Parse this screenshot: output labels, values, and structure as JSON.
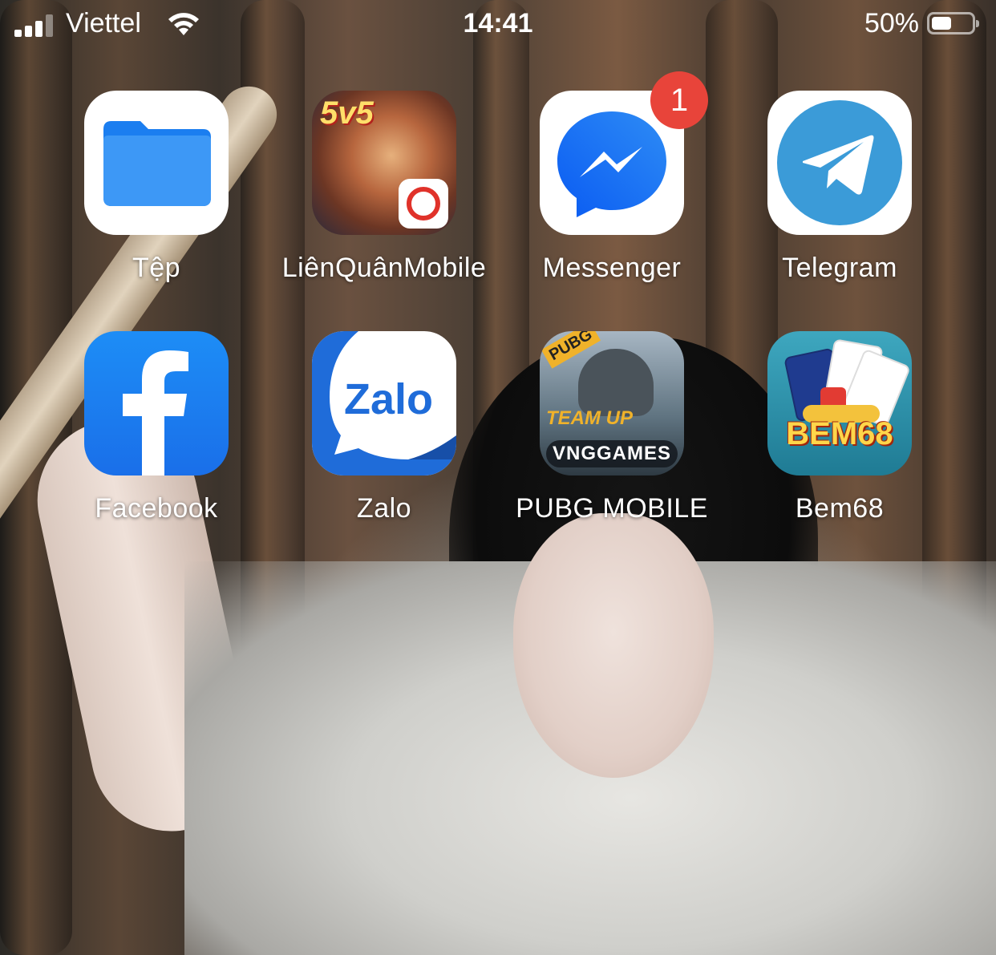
{
  "status_bar": {
    "carrier": "Viettel",
    "time": "14:41",
    "battery_percent_label": "50%",
    "battery_level": 0.5,
    "signal_bars": 3,
    "signal_bars_total": 4
  },
  "apps": [
    {
      "label": "Tệp",
      "icon": "files-folder-icon"
    },
    {
      "label": "LiênQuânMobile",
      "icon": "lien-quan-mobile-icon",
      "icon_text": "5v5"
    },
    {
      "label": "Messenger",
      "icon": "messenger-icon",
      "badge": "1"
    },
    {
      "label": "Telegram",
      "icon": "telegram-icon"
    },
    {
      "label": "Facebook",
      "icon": "facebook-icon"
    },
    {
      "label": "Zalo",
      "icon": "zalo-icon",
      "icon_text": "Zalo"
    },
    {
      "label": "PUBG MOBILE",
      "icon": "pubg-mobile-icon",
      "icon_text_tag": "PUBG",
      "icon_text_team": "TEAM UP",
      "icon_text_publisher": "VNGGAMES"
    },
    {
      "label": "Bem68",
      "icon": "bem68-icon",
      "icon_text": "BEM68"
    }
  ],
  "colors": {
    "badge": "#e8443a",
    "facebook": "#1877f2",
    "messenger": "#1e7cf2",
    "telegram": "#3b9bd8",
    "zalo": "#1f6cd9"
  }
}
